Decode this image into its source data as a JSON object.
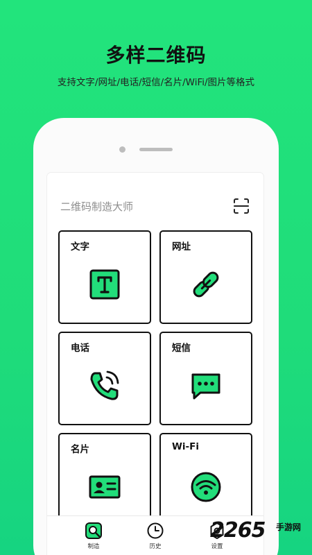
{
  "banner": {
    "headline": "多样二维码",
    "subline": "支持文字/网址/电话/短信/名片/WiFi/图片等格式"
  },
  "app": {
    "title": "二维码制造大师",
    "scan_icon": "scan-icon"
  },
  "cards": [
    {
      "label": "文字",
      "icon": "text-icon"
    },
    {
      "label": "网址",
      "icon": "link-icon"
    },
    {
      "label": "电话",
      "icon": "phone-call-icon"
    },
    {
      "label": "短信",
      "icon": "message-icon"
    },
    {
      "label": "名片",
      "icon": "contact-card-icon"
    },
    {
      "label": "Wi-Fi",
      "icon": "wifi-icon"
    }
  ],
  "tabbar": {
    "tabs": [
      {
        "label": "制造",
        "icon": "search-qr-icon",
        "active": true
      },
      {
        "label": "历史",
        "icon": "clock-icon",
        "active": false
      },
      {
        "label": "设置",
        "icon": "gear-icon",
        "active": false
      }
    ]
  },
  "watermark": {
    "number": "2265",
    "text": "手游网"
  },
  "colors": {
    "accent": "#22dd7a",
    "outline": "#111111",
    "background": "#ffffff"
  }
}
